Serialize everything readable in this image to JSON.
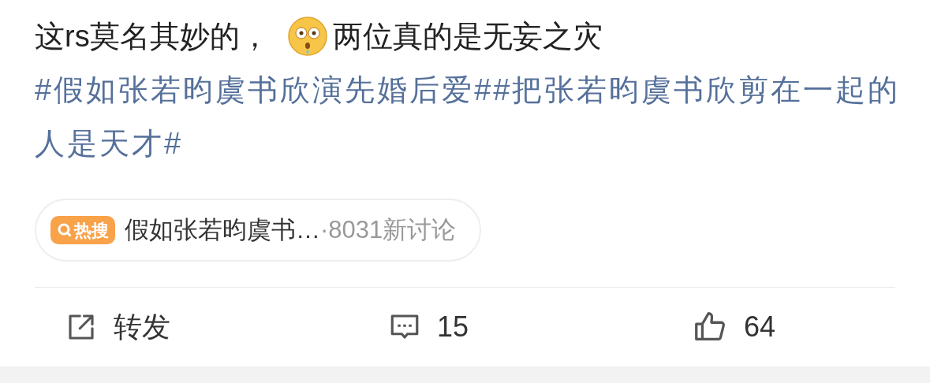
{
  "post": {
    "text_before_emoji": "这rs莫名其妙的，",
    "text_after_emoji": "两位真的是无妄之灾",
    "hashtags": "#假如张若昀虞书欣演先婚后爱##把张若昀虞书欣剪在一起的人是天才#"
  },
  "hot_search": {
    "badge": "热搜",
    "title": "假如张若昀虞书…",
    "count": "·8031新讨论"
  },
  "actions": [
    {
      "kind": "repost",
      "label": "转发"
    },
    {
      "kind": "comment",
      "label": "15"
    },
    {
      "kind": "like",
      "label": "64"
    }
  ]
}
